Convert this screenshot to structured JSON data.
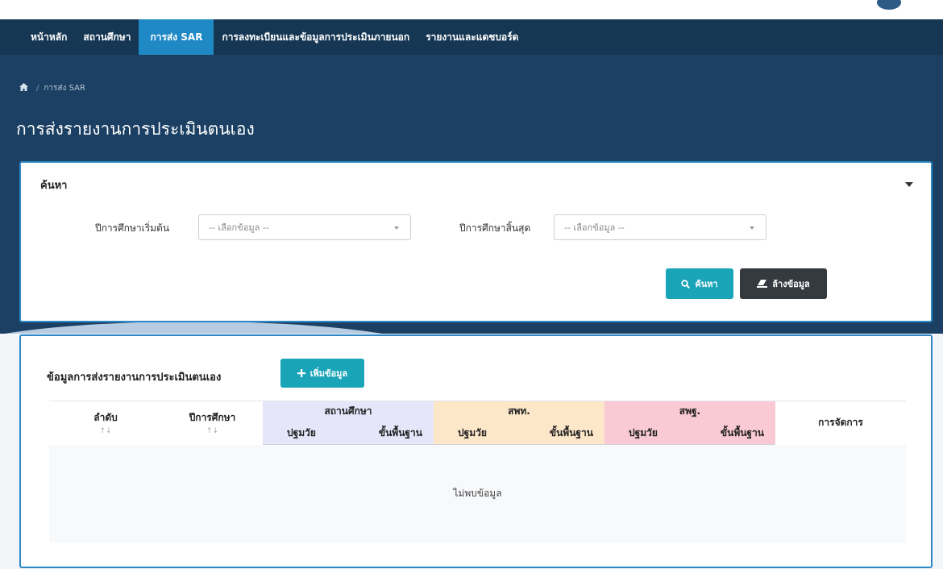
{
  "nav": {
    "items": [
      {
        "label": "หน้าหลัก"
      },
      {
        "label": "สถานศึกษา"
      },
      {
        "label": "การส่ง SAR"
      },
      {
        "label": "การลงทะเบียนและข้อมูลการประเมินภายนอก"
      },
      {
        "label": "รายงานและแดชบอร์ด"
      }
    ],
    "active_index": 2
  },
  "breadcrumb": {
    "home_icon": "home-icon",
    "current": "การส่ง SAR"
  },
  "page_title": "การส่งรายงานการประเมินตนเอง",
  "search": {
    "title": "ค้นหา",
    "start_year_label": "ปีการศึกษาเริ่มต้น",
    "start_year_value": "-- เลือกข้อมูล --",
    "end_year_label": "ปีการศึกษาสิ้นสุด",
    "end_year_value": "-- เลือกข้อมูล --",
    "search_button": "ค้นหา",
    "clear_button": "ล้างข้อมูล"
  },
  "data_section": {
    "title": "ข้อมูลการส่งรายงานการประเมินตนเอง",
    "add_button": "เพิ่มข้อมูล",
    "table": {
      "col_seq": "ลำดับ",
      "col_year": "ปีการศึกษา",
      "group_school": "สถานศึกษา",
      "group_spt": "สพท.",
      "group_spr": "สพฐ.",
      "sub_early": "ปฐมวัย",
      "sub_basic": "ขั้นพื้นฐาน",
      "col_manage": "การจัดการ",
      "sort_icon": "↑↓",
      "empty_text": "ไม่พบข้อมูล"
    }
  },
  "colors": {
    "hero_bg": "#1b4064",
    "nav_bg": "#163754",
    "nav_active": "#1f89c6",
    "card_border": "#2d88c7",
    "btn_teal": "#1aa4b8",
    "btn_dark": "#343a40",
    "school_header": "#e6e6fb",
    "spt_header": "#fde7c9",
    "spr_header": "#f9c9d4"
  }
}
